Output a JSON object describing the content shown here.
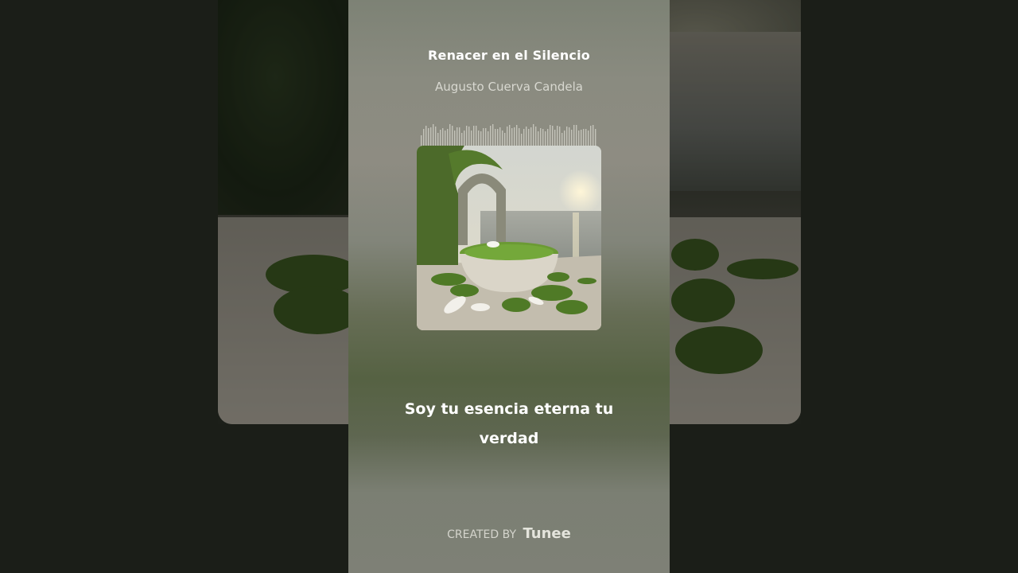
{
  "track": {
    "title": "Renacer en el Silencio",
    "artist": "Augusto Cuerva Candela"
  },
  "cover_art": {
    "icon": "album-cover-image",
    "description_colors": {
      "sky": "#d9d7cb",
      "moss": "#4f7a26",
      "stone": "#bcb7a8"
    }
  },
  "lyrics": {
    "current_line": "Soy tu esencia eterna tu verdad"
  },
  "footer": {
    "created_by_label": "CREATED BY",
    "brand": "Tunee"
  },
  "colors": {
    "panel_top": "#7d8275",
    "panel_mid": "#566243",
    "text": "#ffffff"
  }
}
